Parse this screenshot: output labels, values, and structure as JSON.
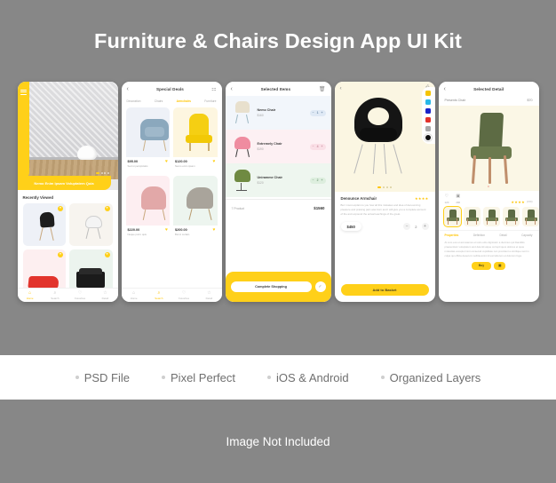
{
  "header": {
    "title": "Furniture & Chairs Design App UI Kit"
  },
  "screens": {
    "home": {
      "hero_caption": "Nemo Enim Ipsam Voluptatem Quia",
      "section_title": "Recently Viewed",
      "menu_icon": "hamburger-menu-icon",
      "tabs": [
        {
          "label": "Home",
          "icon": "home-icon",
          "active": true
        },
        {
          "label": "Search",
          "icon": "search-icon",
          "active": false
        },
        {
          "label": "Favorites",
          "icon": "heart-icon",
          "active": false
        },
        {
          "label": "Detail",
          "icon": "star-icon",
          "active": false
        }
      ]
    },
    "deals": {
      "title": "Special Deals",
      "back_icon": "chevron-left-icon",
      "action_icon": "filter-icon",
      "categories": [
        {
          "label": "Decoration",
          "active": false
        },
        {
          "label": "Chairs",
          "active": false
        },
        {
          "label": "Armchairs",
          "active": true
        },
        {
          "label": "Furniture",
          "active": false
        }
      ],
      "products": [
        {
          "price": "$95.00",
          "desc": "Sed ut perspiciatis"
        },
        {
          "price": "$120.00",
          "desc": "Nemo enim ipsam"
        },
        {
          "price": "$220.00",
          "desc": "Neque porro quis"
        },
        {
          "price": "$200.00",
          "desc": "But in certain"
        }
      ],
      "tabs": [
        {
          "label": "Home",
          "icon": "home-icon",
          "active": false
        },
        {
          "label": "Search",
          "icon": "search-icon",
          "active": true
        },
        {
          "label": "Favorites",
          "icon": "heart-icon",
          "active": false
        },
        {
          "label": "Detail",
          "icon": "star-icon",
          "active": false
        }
      ]
    },
    "cart": {
      "title": "Selected Items",
      "back_icon": "chevron-left-icon",
      "action_icon": "trash-icon",
      "items": [
        {
          "name": "Nemo Chair",
          "price": "$160",
          "qty": "1"
        },
        {
          "name": "Extremely Chair",
          "price": "$190",
          "qty": "4"
        },
        {
          "name": "Uniramme Chair",
          "price": "$120",
          "qty": "2"
        }
      ],
      "summary_label": "7 Product",
      "summary_total": "$1560",
      "cta": "Complete Shopping",
      "confirm_icon": "check-icon"
    },
    "detail": {
      "back_icon": "chevron-left-icon",
      "bookmark_icon": "bookmark-icon",
      "name": "Denounce Armchair",
      "rating": "★★★★",
      "description": "But I must explain to you how all this mistakes and idea of denouncing pleasure and praising pain was born and I will give you a complete account of the and expound the actual teachings of the great.",
      "price": "$450",
      "quantity": "2",
      "minus_icon": "minus-icon",
      "plus_icon": "plus-icon",
      "cta": "Add to Basket",
      "swatches": [
        {
          "name": "yellow",
          "hex": "#f5c400",
          "selected": false
        },
        {
          "name": "cyan",
          "hex": "#29b8e8",
          "selected": false
        },
        {
          "name": "blue",
          "hex": "#1a23c9",
          "selected": false
        },
        {
          "name": "red",
          "hex": "#e3322a",
          "selected": false
        },
        {
          "name": "gray",
          "hex": "#a8a8a8",
          "selected": false
        },
        {
          "name": "black",
          "hex": "#111111",
          "selected": true
        }
      ]
    },
    "selected_detail": {
      "title": "Selected Detail",
      "back_icon": "chevron-left-icon",
      "product_name": "Presents Chair",
      "product_price": "$70",
      "stats": [
        {
          "icon": "heart-icon",
          "value": "120"
        },
        {
          "icon": "bag-icon",
          "value": "290"
        }
      ],
      "rating": "★★★★",
      "rating_count": "(150)",
      "tabs": [
        {
          "label": "Properties",
          "active": true
        },
        {
          "label": "Definition",
          "active": false
        },
        {
          "label": "Detail",
          "active": false
        },
        {
          "label": "Capacity",
          "active": false
        }
      ],
      "body_text": "At vero eos et accusamus et iusto odio dignissim a ducimus qui blanditiis praesentium voluptatum and deleniti atque corrupti quos dolores et quas molestias excepturi sint occaecati cupiditate non provident a similique sunt in culpa qui officia deserunt mollitia animi id est laborum et dolorum fuga.",
      "buy_label": "Buy",
      "bag_icon": "bag-icon"
    }
  },
  "features": [
    {
      "label": "PSD File"
    },
    {
      "label": "Pixel Perfect"
    },
    {
      "label": "iOS & Android"
    },
    {
      "label": "Organized Layers"
    }
  ],
  "footer": {
    "note": "Image Not Included"
  },
  "colors": {
    "background": "#878787",
    "accent": "#ffd019",
    "band": "#ffffff"
  }
}
